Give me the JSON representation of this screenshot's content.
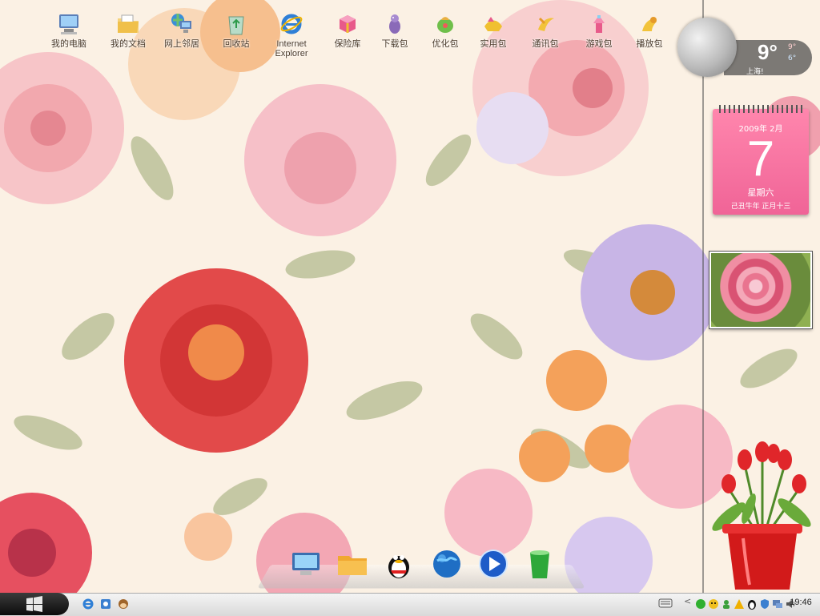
{
  "desktop_icons": [
    {
      "label": "我的电脑",
      "icon": "my-computer-icon"
    },
    {
      "label": "我的文档",
      "icon": "my-documents-icon"
    },
    {
      "label": "网上邻居",
      "icon": "network-places-icon"
    },
    {
      "label": "回收站",
      "icon": "recycle-bin-icon"
    },
    {
      "label": "Internet Explorer",
      "icon": "ie-icon"
    },
    {
      "label": "保险库",
      "icon": "vault-icon"
    },
    {
      "label": "下载包",
      "icon": "download-pack-icon"
    },
    {
      "label": "优化包",
      "icon": "optimize-pack-icon"
    },
    {
      "label": "实用包",
      "icon": "utility-pack-icon"
    },
    {
      "label": "通讯包",
      "icon": "communication-pack-icon"
    },
    {
      "label": "游戏包",
      "icon": "game-pack-icon"
    },
    {
      "label": "播放包",
      "icon": "media-pack-icon"
    }
  ],
  "weather": {
    "temp": "9°",
    "high": "9°",
    "low": "6°",
    "city": "上海!"
  },
  "calendar": {
    "year_month": "2009年  2月",
    "day": "7",
    "weekday": "星期六",
    "lunar": "己丑牛年  正月十三"
  },
  "taskbar": {
    "clock": "19:46"
  },
  "dock": [
    "desktop-icon",
    "folder-icon",
    "qq-penguin-icon",
    "globe-icon",
    "media-player-icon",
    "recycle-bin-icon"
  ],
  "colors": {
    "accent": "#f06497",
    "taskbar": "#e4e4e4",
    "start": "#111111"
  }
}
